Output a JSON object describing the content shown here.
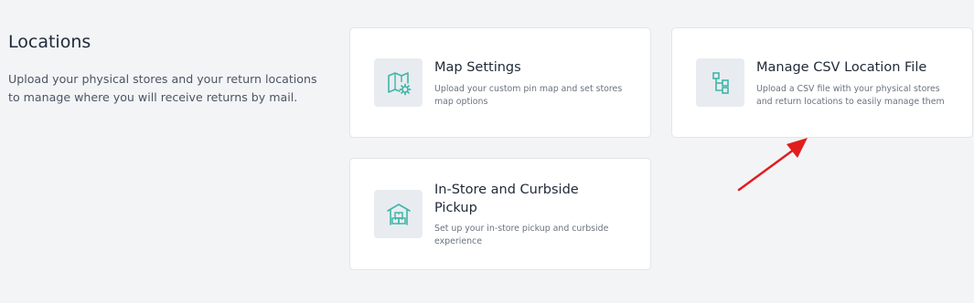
{
  "section": {
    "title": "Locations",
    "description": "Upload your physical stores and your return locations to manage where you will receive returns by mail."
  },
  "cards": [
    {
      "title": "Map Settings",
      "description": "Upload your custom pin map and set stores map options",
      "icon": "map-gear-icon"
    },
    {
      "title": "Manage CSV Location File",
      "description": "Upload a CSV file with your physical stores and return locations to easily manage them",
      "icon": "hierarchy-icon"
    },
    {
      "title": "In-Store and Curbside Pickup",
      "description": "Set up your in-store pickup and curbside experience",
      "icon": "store-pickup-icon"
    }
  ],
  "colors": {
    "accent": "#3fb6a8",
    "annotation": "#e11d1d",
    "background": "#f3f4f6"
  }
}
